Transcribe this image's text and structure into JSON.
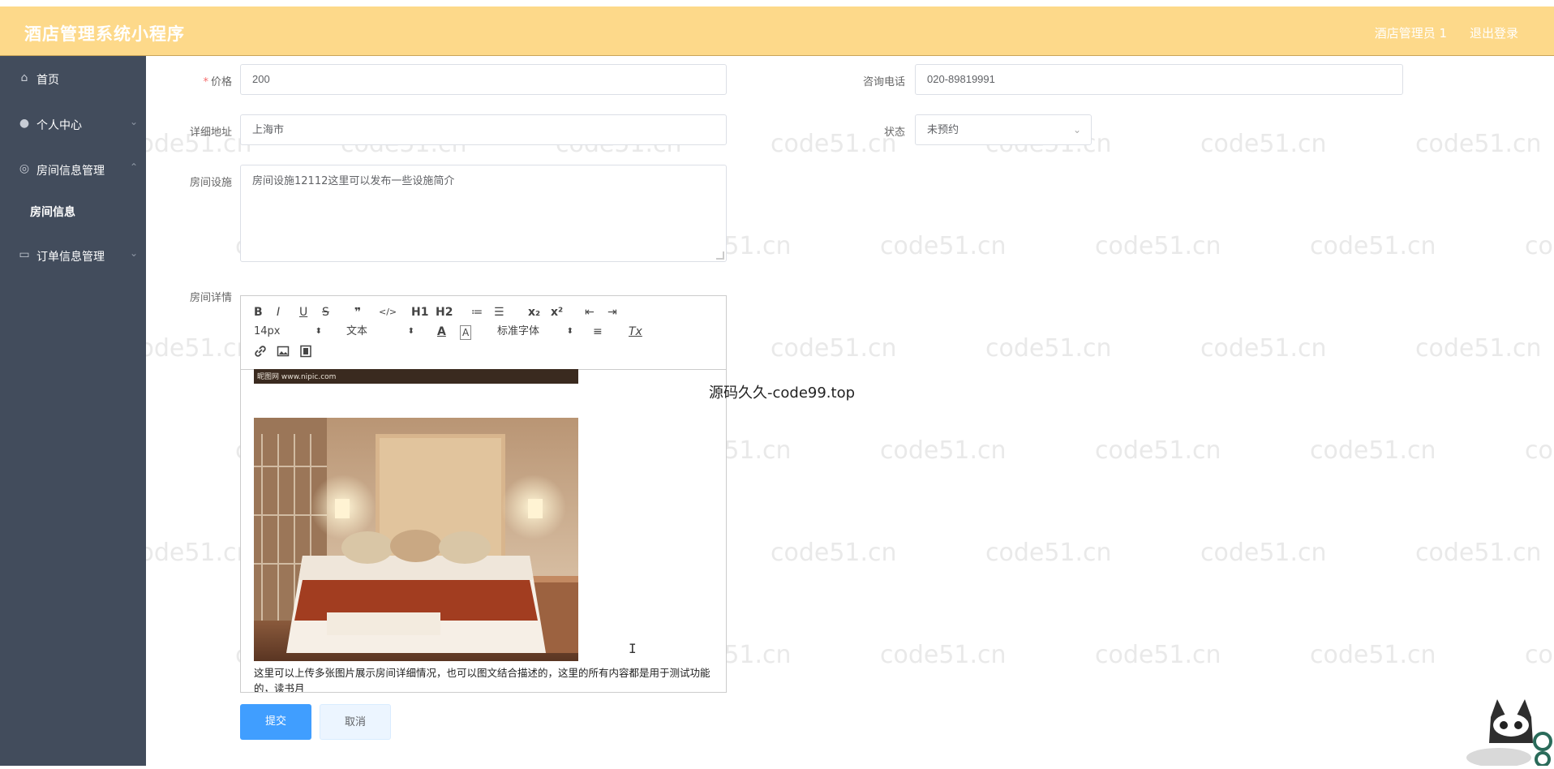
{
  "header": {
    "title": "酒店管理系统小程序",
    "user": "酒店管理员 1",
    "logout": "退出登录"
  },
  "sidebar": {
    "items": [
      {
        "label": "首页",
        "icon": "home-icon"
      },
      {
        "label": "个人中心",
        "icon": "user-icon"
      },
      {
        "label": "房间信息管理",
        "icon": "room-icon"
      },
      {
        "label": "房间信息",
        "icon": ""
      },
      {
        "label": "订单信息管理",
        "icon": "order-icon"
      }
    ]
  },
  "form": {
    "price_label": "价格",
    "price_value": "200",
    "phone_label": "咨询电话",
    "phone_value": "020-89819991",
    "address_label": "详细地址",
    "address_value": "上海市",
    "status_label": "状态",
    "status_value": "未预约",
    "facilities_label": "房间设施",
    "facilities_value": "房间设施12112这里可以发布一些设施简介",
    "details_label": "房间详情"
  },
  "editor": {
    "toolbar": {
      "bold": "B",
      "italic": "I",
      "underline": "U",
      "strike": "S",
      "quote": "❞",
      "code": "</>",
      "h1": "H1",
      "h2": "H2",
      "ol": "≔",
      "ul": "☰",
      "sub": "x₂",
      "sup": "x²",
      "outdent": "⇤",
      "indent": "⇥",
      "font_size": "14px",
      "text_type": "文本",
      "font_family": "标准字体",
      "color": "A",
      "background": "A",
      "align": "≡",
      "clean": "Tx"
    },
    "image_strip_caption": "昵图网 www.nipic.com",
    "body_text": "这里可以上传多张图片展示房间详细情况，也可以图文结合描述的，这里的所有内容都是用于测试功能的，读书月"
  },
  "overlay_text": "源码久久-code99.top",
  "buttons": {
    "submit": "提交",
    "cancel": "取消"
  },
  "watermark": "code51.cn",
  "colors": {
    "header": "#fdd98a",
    "sidebar": "#424c5c",
    "primary": "#409eff"
  }
}
